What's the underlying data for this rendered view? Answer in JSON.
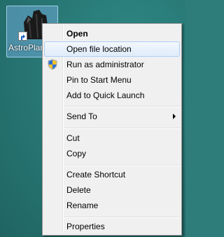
{
  "desktop": {
    "icon": {
      "label": "AstroPlanner",
      "icon": "app-shortcut-icon",
      "shortcut_overlay": "shortcut-arrow-icon"
    }
  },
  "context_menu": {
    "items": [
      {
        "label": "Open",
        "bold": true
      },
      {
        "label": "Open file location",
        "highlighted": true
      },
      {
        "label": "Run as administrator",
        "icon": "uac-shield-icon"
      },
      {
        "label": "Pin to Start Menu"
      },
      {
        "label": "Add to Quick Launch"
      },
      {
        "label": "Send To",
        "submenu": true
      },
      {
        "label": "Cut"
      },
      {
        "label": "Copy"
      },
      {
        "label": "Create Shortcut"
      },
      {
        "label": "Delete"
      },
      {
        "label": "Rename"
      },
      {
        "label": "Properties"
      }
    ]
  },
  "colors": {
    "desktop_background": "#277573",
    "menu_background": "#f0f0f0",
    "highlight_border": "#aecff7"
  }
}
